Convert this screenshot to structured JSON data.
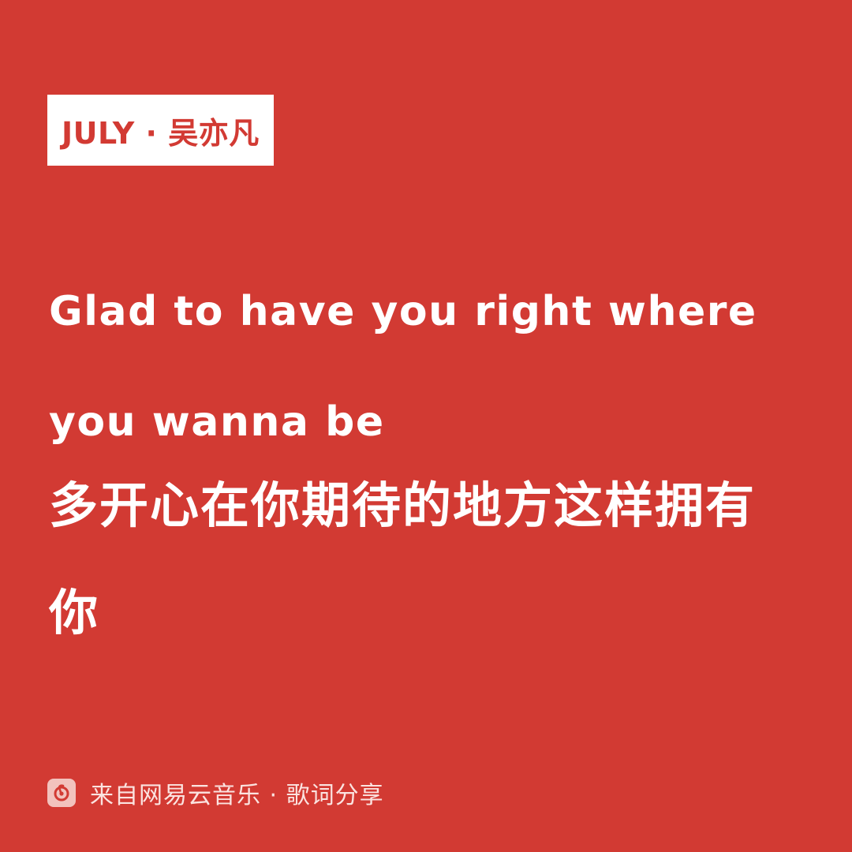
{
  "header": {
    "song_artist": "JULY · 吴亦凡"
  },
  "lyrics": {
    "english": "Glad to have you right where you wanna be",
    "chinese": "多开心在你期待的地方这样拥有你"
  },
  "footer": {
    "icon": "netease-music-icon",
    "text": "来自网易云音乐 · 歌词分享"
  },
  "colors": {
    "background": "#d23a33",
    "tag_background": "#ffffff",
    "lyric_text": "#ffffff"
  }
}
